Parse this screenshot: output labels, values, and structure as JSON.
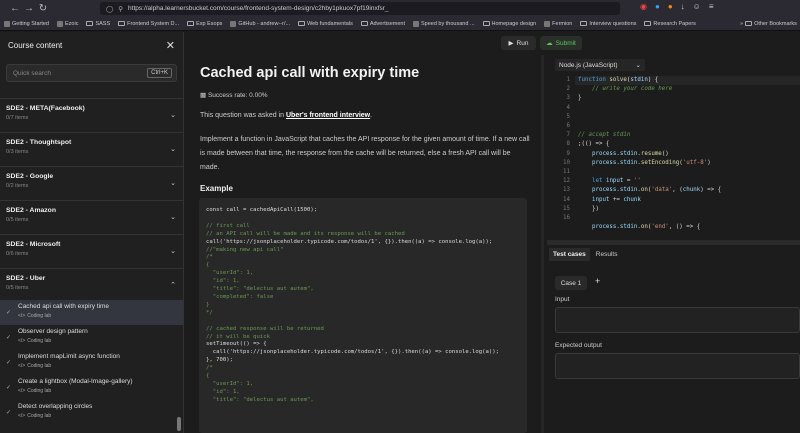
{
  "browser": {
    "url": "https://alpha.learnersbucket.com/course/frontend-system-design/c2hby1pkuox7pf19inxfsr_",
    "bookmarks": [
      "Getting Started",
      "Ezoic",
      "SASS",
      "Frontend System D...",
      "Exp Esops",
      "GitHub - andrew--r/...",
      "Web fundamentals",
      "Advertisement",
      "Speed by thousand ...",
      "Homepage design",
      "Fermion",
      "Interview questions",
      "Research Papers"
    ],
    "other_bookmarks": "Other Bookmarks"
  },
  "sidebar": {
    "title": "Course content",
    "search_placeholder": "Quick search",
    "search_shortcut": "Ctrl+K",
    "sections": [
      {
        "title": "SDE2 - META(Facebook)",
        "items": "0/7 items"
      },
      {
        "title": "SDE2 - Thoughtspot",
        "items": "0/3 items"
      },
      {
        "title": "SDE2 - Google",
        "items": "0/2 items"
      },
      {
        "title": "SDE2 - Amazon",
        "items": "0/5 items"
      },
      {
        "title": "SDE2 - Microsoft",
        "items": "0/6 items"
      },
      {
        "title": "SDE2 - Uber",
        "items": "0/5 items"
      }
    ],
    "lessons": [
      {
        "title": "Cached api call with expiry time",
        "type": "Coding lab"
      },
      {
        "title": "Observer design pattern",
        "type": "Coding lab"
      },
      {
        "title": "Implement mapLimit async function",
        "type": "Coding lab"
      },
      {
        "title": "Create a lightbox (Modal-Image-gallery)",
        "type": "Coding lab"
      },
      {
        "title": "Detect overlapping circles",
        "type": "Coding lab"
      }
    ]
  },
  "toolbar": {
    "run_label": "Run",
    "submit_label": "Submit"
  },
  "problem": {
    "title": "Cached api call with expiry time",
    "success_rate": "Success rate: 0.00%",
    "asked_prefix": "This question was asked in ",
    "asked_link": "Uber's frontend interview",
    "asked_suffix": ".",
    "description": "Implement a function in JavaScript that caches the API response for the given amount of time. If a new call is made between that time, the response from the cache will be returned, else a fresh API call will be made.",
    "example_heading": "Example"
  },
  "example_code": [
    "const call = cachedApiCall(1500);",
    "",
    "// first call",
    "// an API call will be made and its response will be cached",
    "call('https://jsonplaceholder.typicode.com/todos/1', {}).then((a) => console.log(a));",
    "//\"making new api call\"",
    "/*",
    "{",
    "  \"userId\": 1,",
    "  \"id\": 1,",
    "  \"title\": \"delectus aut autem\",",
    "  \"completed\": false",
    "}",
    "*/",
    "",
    "// cached response will be returned",
    "// it will be quick",
    "setTimeout(() => {",
    "  call('https://jsonplaceholder.typicode.com/todos/1', {}).then((a) => console.log(a));",
    "}, 700);",
    "/*",
    "{",
    "  \"userId\": 1,",
    "  \"id\": 1,",
    "  \"title\": \"delectus aut autem\","
  ],
  "editor": {
    "language": "Node.js (JavaScript)",
    "line_numbers": [
      "1",
      "2",
      "3",
      "4",
      "5",
      "6",
      "7",
      "8",
      "9",
      "10",
      "11",
      "12",
      "13",
      "14",
      "15",
      "16"
    ]
  },
  "tests": {
    "tabs": [
      "Test cases",
      "Results"
    ],
    "case_label": "Case 1",
    "add_symbol": "+",
    "input_label": "Input",
    "expected_label": "Expected output"
  }
}
